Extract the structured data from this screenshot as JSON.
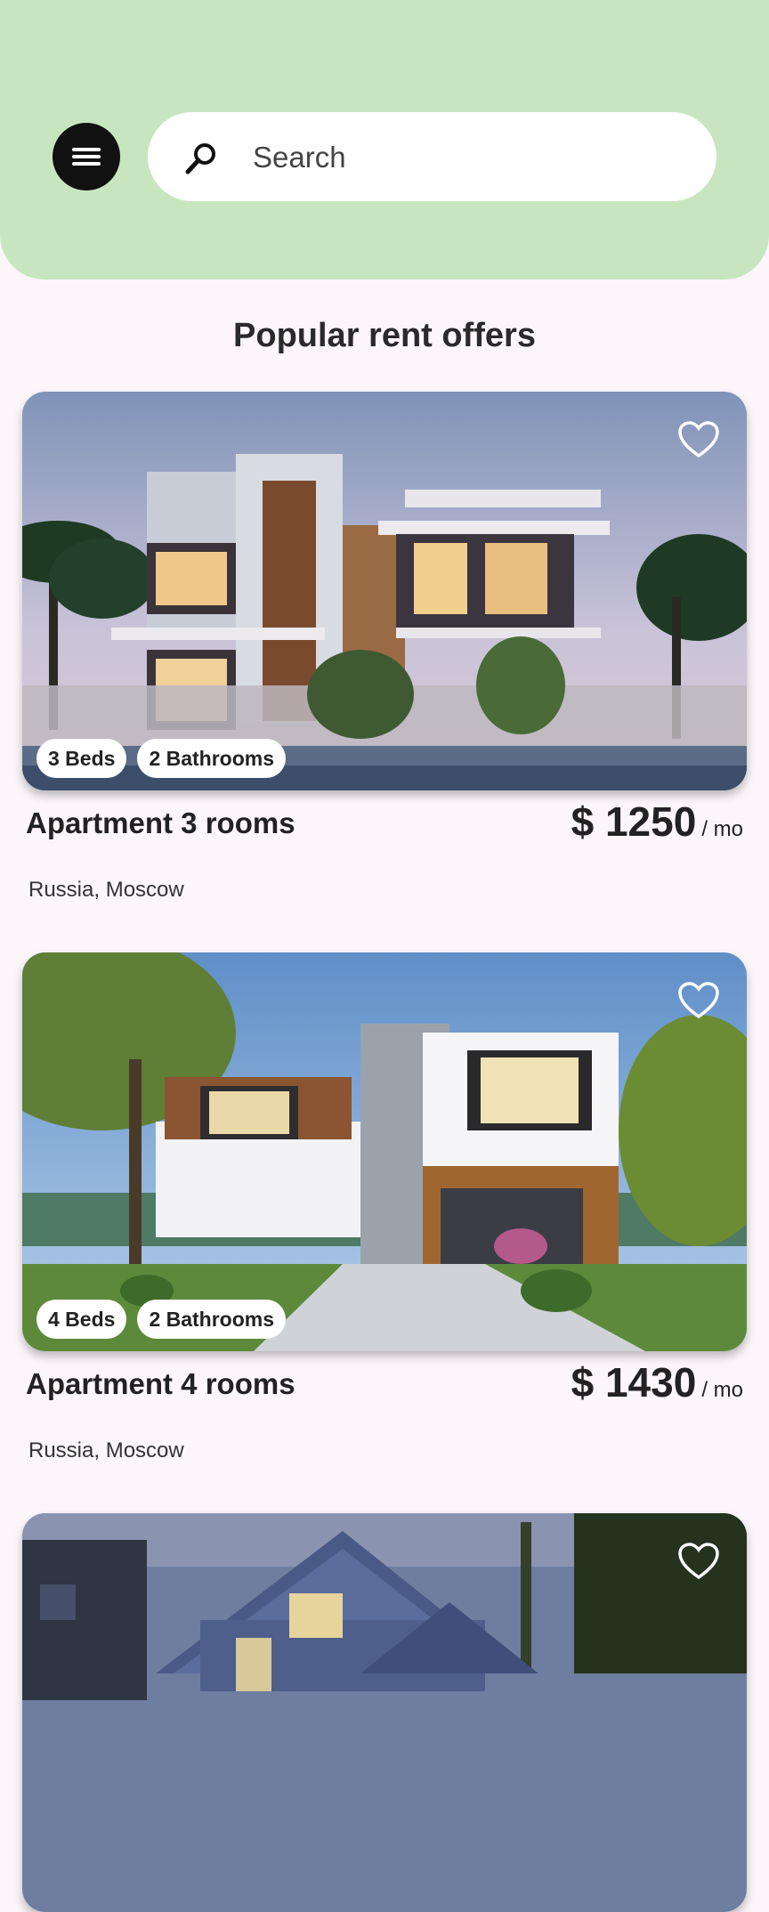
{
  "header": {
    "search_placeholder": "Search",
    "accent": "#c7e6c0"
  },
  "section_title": "Popular rent offers",
  "listings": [
    {
      "title": "Apartment 3 rooms",
      "price": "$ 1250",
      "period": "/ mo",
      "location": "Russia, Moscow",
      "beds": "3 Beds",
      "baths": "2 Bathrooms"
    },
    {
      "title": "Apartment 4 rooms",
      "price": "$ 1430",
      "period": "/ mo",
      "location": "Russia, Moscow",
      "beds": "4 Beds",
      "baths": "2 Bathrooms"
    },
    {
      "title": "",
      "price": "",
      "period": "",
      "location": "",
      "beds": "",
      "baths": ""
    }
  ],
  "icons": {
    "menu": "menu-icon",
    "search": "search-icon",
    "favorite": "heart-outline-icon"
  }
}
